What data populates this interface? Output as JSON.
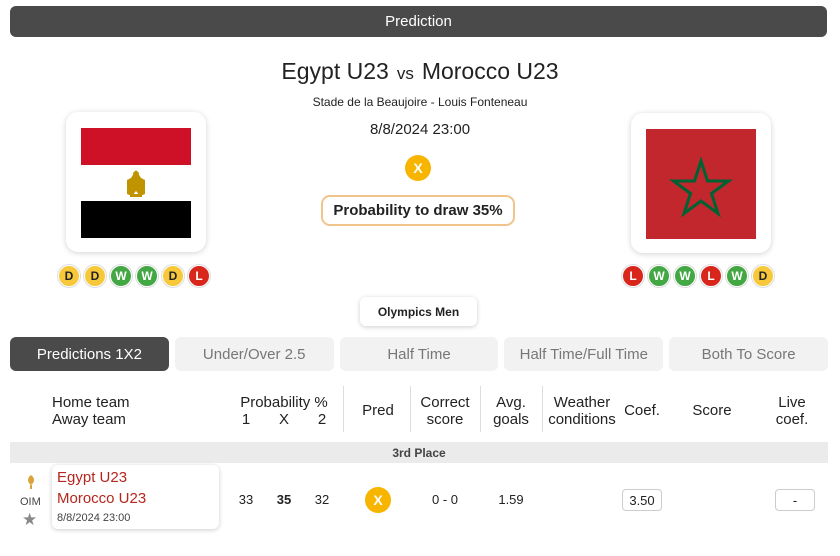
{
  "header": {
    "title": "Prediction"
  },
  "match": {
    "home_team": "Egypt U23",
    "vs": "vs",
    "away_team": "Morocco U23",
    "stadium": "Stade de la Beaujoire - Louis Fonteneau",
    "datetime": "8/8/2024 23:00",
    "prediction": "X",
    "probability_text": "Probability to draw 35%"
  },
  "home_form": [
    "D",
    "D",
    "W",
    "W",
    "D",
    "L"
  ],
  "away_form": [
    "L",
    "W",
    "W",
    "L",
    "W",
    "D"
  ],
  "league": "Olympics Men",
  "tabs": [
    {
      "label": "Predictions 1X2",
      "active": true
    },
    {
      "label": "Under/Over 2.5",
      "active": false
    },
    {
      "label": "Half Time",
      "active": false
    },
    {
      "label": "Half Time/Full Time",
      "active": false
    },
    {
      "label": "Both To Score",
      "active": false
    }
  ],
  "table_header": {
    "home_team": "Home team",
    "away_team": "Away team",
    "probability": "Probability %",
    "p1": "1",
    "px": "X",
    "p2": "2",
    "pred": "Pred",
    "correct": "Correct",
    "score_word": "score",
    "avg": "Avg.",
    "goals": "goals",
    "weather": "Weather",
    "conditions": "conditions",
    "coef": "Coef.",
    "score": "Score",
    "live": "Live",
    "live_coef": "coef."
  },
  "section_title": "3rd Place",
  "row": {
    "league_short": "OIM",
    "home": "Egypt U23",
    "away": "Morocco U23",
    "datetime": "8/8/2024 23:00",
    "prob_1": "33",
    "prob_x": "35",
    "prob_2": "32",
    "pred": "X",
    "correct_score": "0 - 0",
    "avg_goals": "1.59",
    "coef": "3.50",
    "live_coef": "-"
  },
  "colors": {
    "header_bg": "#4a4a4a",
    "pred_badge": "#f7b500",
    "draw": "#f7c93a",
    "win": "#43a743",
    "loss": "#d9261c",
    "team_link": "#b5261e"
  }
}
